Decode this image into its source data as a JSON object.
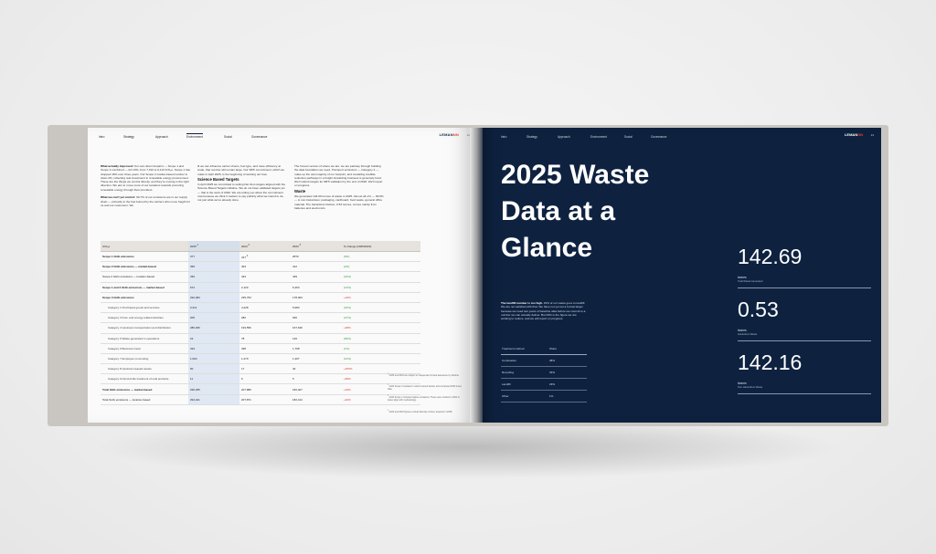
{
  "brand": {
    "name": "LEMAN",
    "accent": "NN"
  },
  "left_page": {
    "nav": [
      "Intro",
      "Strategy",
      "Approach",
      "Environment",
      "Social",
      "Governance"
    ],
    "active_nav": "Environment",
    "page_number": "12",
    "col1_p1_lead": "What actually improved:",
    "col1_p1": "Our own direct footprint — Scope 1 and Scope 2 combined — fell 13%, from 7,310 to 6,113 tCO₂e. Scope 1 has dropped 16% over three years. Our Scope 2 market-based number is down 2%, reflecting real investment in renewable energy procurement. These are the things we control directly, and they're moving in the right direction. We aim to move more of our locations towards procuring renewable energy through their providers.",
    "col1_p2_lead": "What we can't yet control:",
    "col1_p2": "90.7% of our emissions are in our supply chain — primarily in the fuel burned by the carriers who move freight for us and our customers. We",
    "col2_p1": "tll we can influence carrier choice, fuel type, and route efficiency at scale, that number will remain large. Our SBTi commitment, which we made in April 2025, is the beginning of working out how.",
    "col2_heading": "Science Based Targets",
    "col2_p2": "In April 2025 we committed to setting Net Zero targets aligned with the Science Based Targets initiative. We do not have validated targets yet — that is the work of 2026. We are telling you about the commitment now because we think it matters to say publicly what we intend to do, not just what we've already done.",
    "col3_p1": "The honest version of where we are: we are partway through building the data foundation we need. Transport emissions — Category 4 — make up the vast majority of our footprint, and modelling credible reduction pathways in a freight forwarding business is genuinely hard. We'll submit targets for SBTi validation by the end of 2026. We'll report on progress.",
    "col3_heading": "Waste",
    "col3_p2": "We generated 142.69 tonnes of waste in 2025. Almost all of it — 99.6% — is non-hazardous: packaging, cardboard, food waste, general office material. The hazardous fraction, 0.53 tonnes, comes mainly from batteries and electronics.",
    "table": {
      "headers": [
        "tCO₂e",
        "2025",
        "2024",
        "2023",
        "% change (2025/2024)"
      ],
      "header_marks": [
        "",
        "1",
        "2",
        "3",
        ""
      ],
      "rows": [
        {
          "label": "Scope 1 GHG emissions",
          "style": "bold",
          "v2025": "377",
          "v2024": "417",
          "m2024": "4",
          "v2023": "2870",
          "change": "(9%)",
          "sign": "pos"
        },
        {
          "label": "Scope 2 GHG emissions — market-based",
          "style": "bold",
          "v2025": "395",
          "v2024": "403",
          "v2023": "412",
          "change": "(2%)",
          "sign": "pos"
        },
        {
          "label": "Scope 2 GHG emissions — location-based",
          "style": "normal",
          "v2025": "330",
          "v2024": "434",
          "v2023": "439",
          "change": "(24%)",
          "sign": "pos"
        },
        {
          "label": "Scope 1 and 2 GHG emissions — market-based",
          "style": "bold",
          "v2025": "672",
          "v2024": "2,120",
          "v2023": "6,463",
          "change": "(13%)",
          "sign": "pos"
        },
        {
          "label": "Scope 3 GHG emissions",
          "style": "bold",
          "v2025": "292,484",
          "v2024": "235,753",
          "v2023": "178,003",
          "change": "+24%",
          "sign": "neg"
        },
        {
          "label": "Category 1 Purchased goods and services",
          "style": "sub",
          "v2025": "3,311",
          "v2024": "4,228",
          "v2023": "5,083",
          "change": "(22%)",
          "sign": "pos"
        },
        {
          "label": "Category 3 Fuel- and energy-related activities",
          "style": "sub",
          "v2025": "205",
          "v2024": "282",
          "v2023": "630",
          "change": "(27%)",
          "sign": "pos"
        },
        {
          "label": "Category 4 Upstream transportation and distribution",
          "style": "sub",
          "v2025": "286,466",
          "v2024": "193,556",
          "v2023": "167,646",
          "change": "+48%",
          "sign": "neg"
        },
        {
          "label": "Category 5 Waste generated in operations",
          "style": "sub",
          "v2025": "23",
          "v2024": "78",
          "v2023": "126",
          "change": "(69%)",
          "sign": "pos"
        },
        {
          "label": "Category 6 Business travel",
          "style": "sub",
          "v2025": "334",
          "v2024": "338",
          "v2023": "1,708",
          "change": "(1%)",
          "sign": "pos"
        },
        {
          "label": "Category 7 Employee commuting",
          "style": "sub",
          "v2025": "1,094",
          "v2024": "1,270",
          "v2023": "1,407",
          "change": "(14%)",
          "sign": "pos"
        },
        {
          "label": "Category 8 Upstream leased assets",
          "style": "sub",
          "v2025": "60",
          "v2024": "17",
          "v2023": "40",
          "change": "+253%",
          "sign": "neg"
        },
        {
          "label": "Category 12 End-of-life treatment of sold products",
          "style": "sub",
          "v2025": "11",
          "v2024": "6",
          "v2023": "5",
          "change": "+83%",
          "sign": "neg"
        },
        {
          "label": "Total GHG emissions — market-based",
          "style": "bold",
          "v2025": "296,455",
          "v2024": "207,880",
          "v2023": "182,407",
          "change": "+43%",
          "sign": "neg"
        },
        {
          "label": "Total GHG emissions — location-based",
          "style": "normal",
          "v2025": "294,421",
          "v2024": "207,871",
          "v2023": "182,414",
          "change": "+42%",
          "sign": "neg"
        }
      ]
    },
    "footnotes": [
      "2025 and 2024 are subject to independent limited assurance by Deloitte.",
      "2024 Scope 3 restated to reflect revised tracker and completed 2024 travel data.",
      "2023 Scope 1 includes fugitive emissions. These were omitted in 2024 to better align with methodology.",
      "2023 and 2024 figures exclude Mentay Limited, acquired in 2025."
    ]
  },
  "right_page": {
    "nav": [
      "Intro",
      "Strategy",
      "Approach",
      "Environment",
      "Social",
      "Governance"
    ],
    "page_number": "13",
    "title_lines": [
      "2025 Waste",
      "Data at a",
      "Glance"
    ],
    "intro_lead": "The landfill number is too high.",
    "intro_text": "29% of our waste goes to landfill. We are not satisfied with that. We have not yet set a formal target because we need two years of baseline data before we commit to a number we can actually deliver. But 29% is the figure we are working to reduce, and we will report on progress.",
    "treatment_table": {
      "headers": [
        "Treatment method",
        "Share"
      ],
      "rows": [
        {
          "method": "Combustion",
          "share": "38%"
        },
        {
          "method": "Recycling",
          "share": "33%"
        },
        {
          "method": "Landfill",
          "share": "29%"
        },
        {
          "method": "Other",
          "share": "1%"
        }
      ]
    },
    "stats": [
      {
        "value": "142.69",
        "unit": "tonnes",
        "label": "Total Waste Generated"
      },
      {
        "value": "0.53",
        "unit": "tonnes",
        "label": "Hazardous Waste"
      },
      {
        "value": "142.16",
        "unit": "tonnes",
        "label": "Non-Hazardous Waste"
      }
    ]
  }
}
